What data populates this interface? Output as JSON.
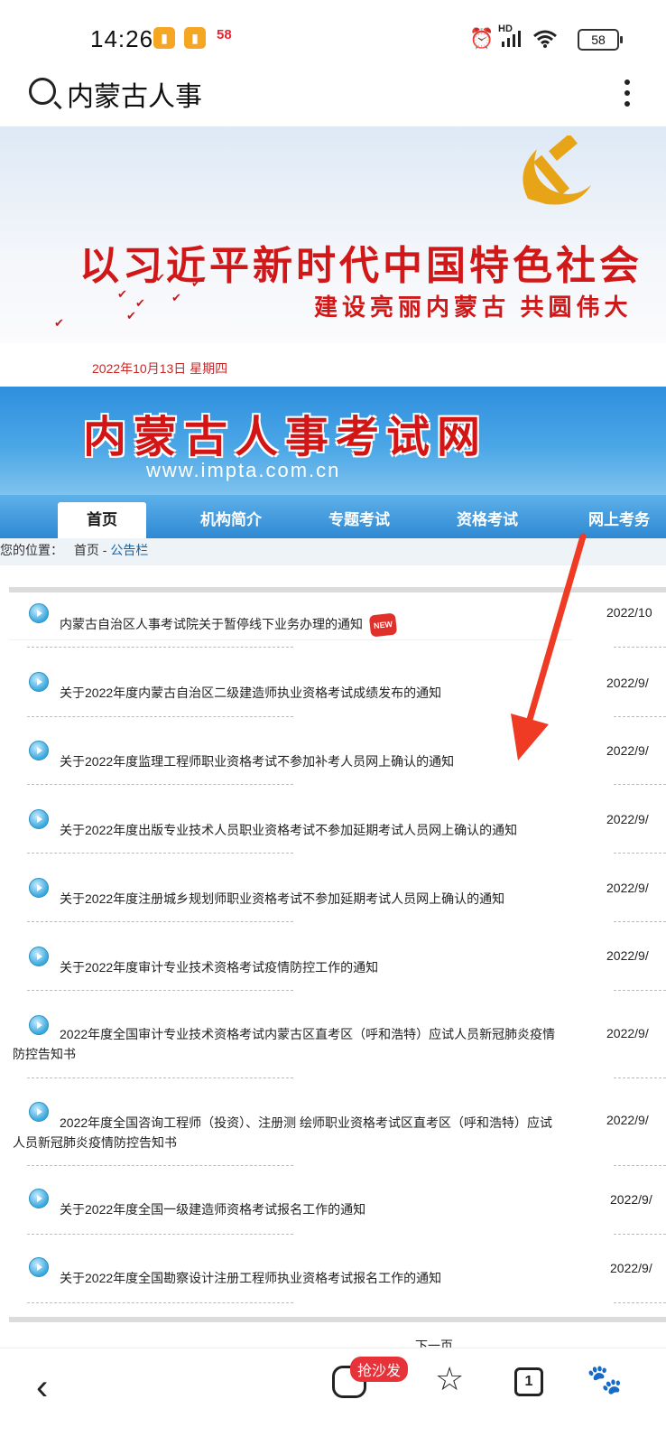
{
  "status_bar": {
    "time": "14:26",
    "app_badge": "58",
    "network_label": "HD",
    "battery": "58"
  },
  "search": {
    "query": "内蒙古人事"
  },
  "banner": {
    "slogan": "以习近平新时代中国特色社会",
    "subtitle": "建设亮丽内蒙古 共圆伟大",
    "date": "2022年10月13日 星期四"
  },
  "site": {
    "title": "内蒙古人事考试网",
    "url": "www.impta.com.cn"
  },
  "nav": {
    "items": [
      "首页",
      "机构简介",
      "专题考试",
      "资格考试",
      "网上考务"
    ],
    "active": "首页"
  },
  "breadcrumb": {
    "label": "您的位置：",
    "home": "首页",
    "separator": " - ",
    "current": "公告栏"
  },
  "notices": [
    {
      "title": "内蒙古自治区人事考试院关于暂停线下业务办理的通知",
      "date": "2022/10",
      "is_new": true,
      "new_label": "NEW"
    },
    {
      "title": "关于2022年度内蒙古自治区二级建造师执业资格考试成绩发布的通知",
      "date": "2022/9/"
    },
    {
      "title": "关于2022年度监理工程师职业资格考试不参加补考人员网上确认的通知",
      "date": "2022/9/"
    },
    {
      "title": "关于2022年度出版专业技术人员职业资格考试不参加延期考试人员网上确认的通知",
      "date": "2022/9/"
    },
    {
      "title": "关于2022年度注册城乡规划师职业资格考试不参加延期考试人员网上确认的通知",
      "date": "2022/9/"
    },
    {
      "title": "关于2022年度审计专业技术资格考试疫情防控工作的通知",
      "date": "2022/9/"
    },
    {
      "title": "2022年度全国审计专业技术资格考试内蒙古区直考区（呼和浩特）应试人员新冠肺炎疫情防控告知书",
      "date": "2022/9/"
    },
    {
      "title": "2022年度全国咨询工程师（投资）、注册测 绘师职业资格考试区直考区（呼和浩特）应试人员新冠肺炎疫情防控告知书",
      "date": "2022/9/"
    },
    {
      "title": "关于2022年度全国一级建造师资格考试报名工作的通知",
      "date": "2022/9/"
    },
    {
      "title": "关于2022年度全国勘察设计注册工程师执业资格考试报名工作的通知",
      "date": "2022/9/"
    }
  ],
  "pagination": {
    "next": "下一页"
  },
  "bottom_bar": {
    "badge": "抢沙发",
    "tabs_count": "1"
  },
  "colors": {
    "accent_red": "#d41515",
    "nav_blue": "#2f88d2",
    "arrow_red": "#ef3b24"
  }
}
